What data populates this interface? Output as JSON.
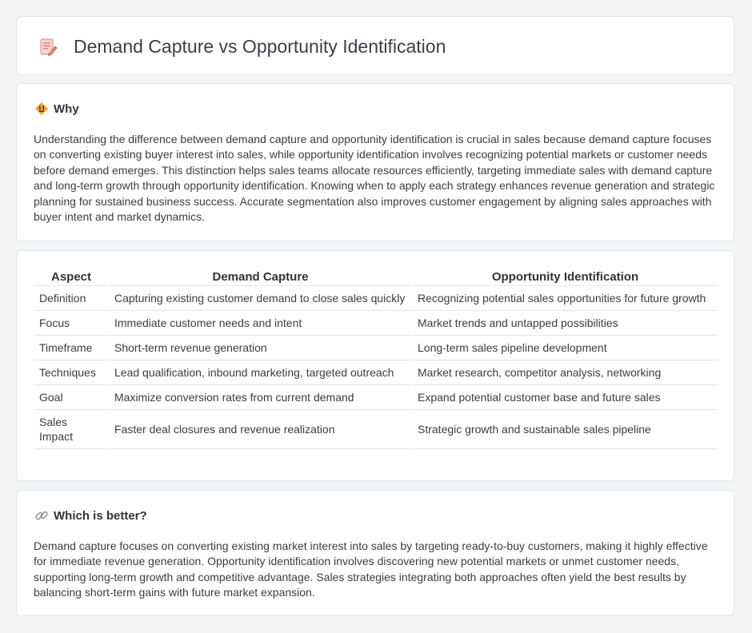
{
  "header": {
    "title": "Demand Capture vs Opportunity Identification",
    "icon": "document-pencil-icon"
  },
  "why": {
    "title": "Why",
    "icon": "diamond-warning-icon",
    "text": "Understanding the difference between demand capture and opportunity identification is crucial in sales because demand capture focuses on converting existing buyer interest into sales, while opportunity identification involves recognizing potential markets or customer needs before demand emerges. This distinction helps sales teams allocate resources efficiently, targeting immediate sales with demand capture and long-term growth through opportunity identification. Knowing when to apply each strategy enhances revenue generation and strategic planning for sustained business success. Accurate segmentation also improves customer engagement by aligning sales approaches with buyer intent and market dynamics."
  },
  "table": {
    "headers": [
      "Aspect",
      "Demand Capture",
      "Opportunity Identification"
    ],
    "rows": [
      [
        "Definition",
        "Capturing existing customer demand to close sales quickly",
        "Recognizing potential sales opportunities for future growth"
      ],
      [
        "Focus",
        "Immediate customer needs and intent",
        "Market trends and untapped possibilities"
      ],
      [
        "Timeframe",
        "Short-term revenue generation",
        "Long-term sales pipeline development"
      ],
      [
        "Techniques",
        "Lead qualification, inbound marketing, targeted outreach",
        "Market research, competitor analysis, networking"
      ],
      [
        "Goal",
        "Maximize conversion rates from current demand",
        "Expand potential customer base and future sales"
      ],
      [
        "Sales Impact",
        "Faster deal closures and revenue realization",
        "Strategic growth and sustainable sales pipeline"
      ]
    ]
  },
  "better": {
    "title": "Which is better?",
    "icon": "link-icon",
    "text": "Demand capture focuses on converting existing market interest into sales by targeting ready-to-buy customers, making it highly effective for immediate revenue generation. Opportunity identification involves discovering new potential markets or unmet customer needs, supporting long-term growth and competitive advantage. Sales strategies integrating both approaches often yield the best results by balancing short-term gains with future market expansion."
  },
  "colors": {
    "background": "#f3f4f6",
    "card": "#ffffff",
    "accent_orange": "#f0a23a"
  }
}
